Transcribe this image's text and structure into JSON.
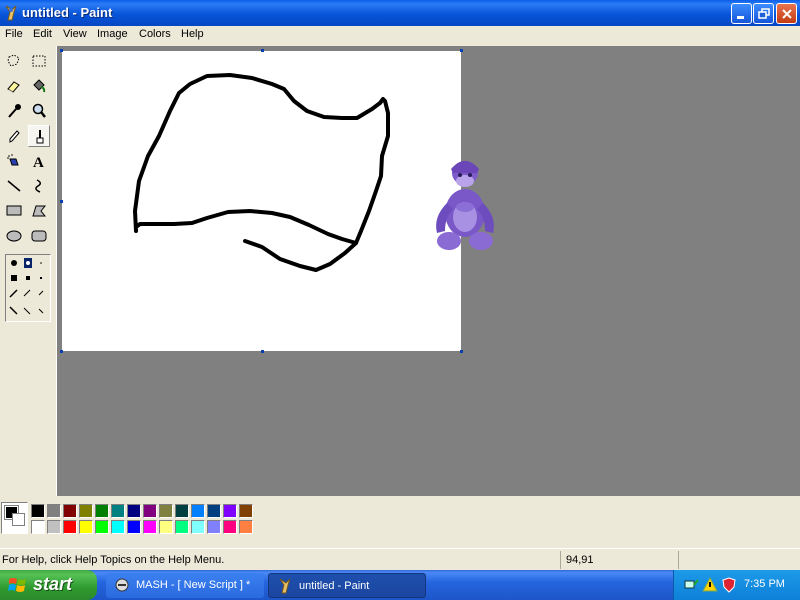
{
  "window": {
    "title": "untitled - Paint"
  },
  "menu": [
    "File",
    "Edit",
    "View",
    "Image",
    "Colors",
    "Help"
  ],
  "tools": [
    {
      "name": "free-form-select-icon"
    },
    {
      "name": "select-icon"
    },
    {
      "name": "eraser-icon"
    },
    {
      "name": "fill-bucket-icon"
    },
    {
      "name": "pick-color-icon"
    },
    {
      "name": "magnifier-icon"
    },
    {
      "name": "pencil-icon"
    },
    {
      "name": "brush-icon",
      "selected": true
    },
    {
      "name": "airbrush-icon"
    },
    {
      "name": "text-icon"
    },
    {
      "name": "line-icon"
    },
    {
      "name": "curve-icon"
    },
    {
      "name": "rectangle-icon"
    },
    {
      "name": "polygon-icon"
    },
    {
      "name": "ellipse-icon"
    },
    {
      "name": "rounded-rectangle-icon"
    }
  ],
  "palette": {
    "foreground": "#000000",
    "background": "#ffffff",
    "top_row": [
      "#000000",
      "#808080",
      "#800000",
      "#808000",
      "#008000",
      "#008080",
      "#000080",
      "#800080",
      "#808040",
      "#004040",
      "#0080ff",
      "#004080",
      "#8000ff",
      "#804000"
    ],
    "bottom_row": [
      "#ffffff",
      "#c0c0c0",
      "#ff0000",
      "#ffff00",
      "#00ff00",
      "#00ffff",
      "#0000ff",
      "#ff00ff",
      "#ffff80",
      "#00ff80",
      "#80ffff",
      "#8080ff",
      "#ff0080",
      "#ff8040"
    ]
  },
  "status": {
    "help_text": "For Help, click Help Topics on the Help Menu.",
    "coords": "94,91"
  },
  "taskbar": {
    "start_label": "start",
    "tasks": [
      {
        "label": "MASH - [ New Script ] *"
      },
      {
        "label": "untitled - Paint",
        "active": true
      }
    ],
    "time": "7:35 PM"
  }
}
